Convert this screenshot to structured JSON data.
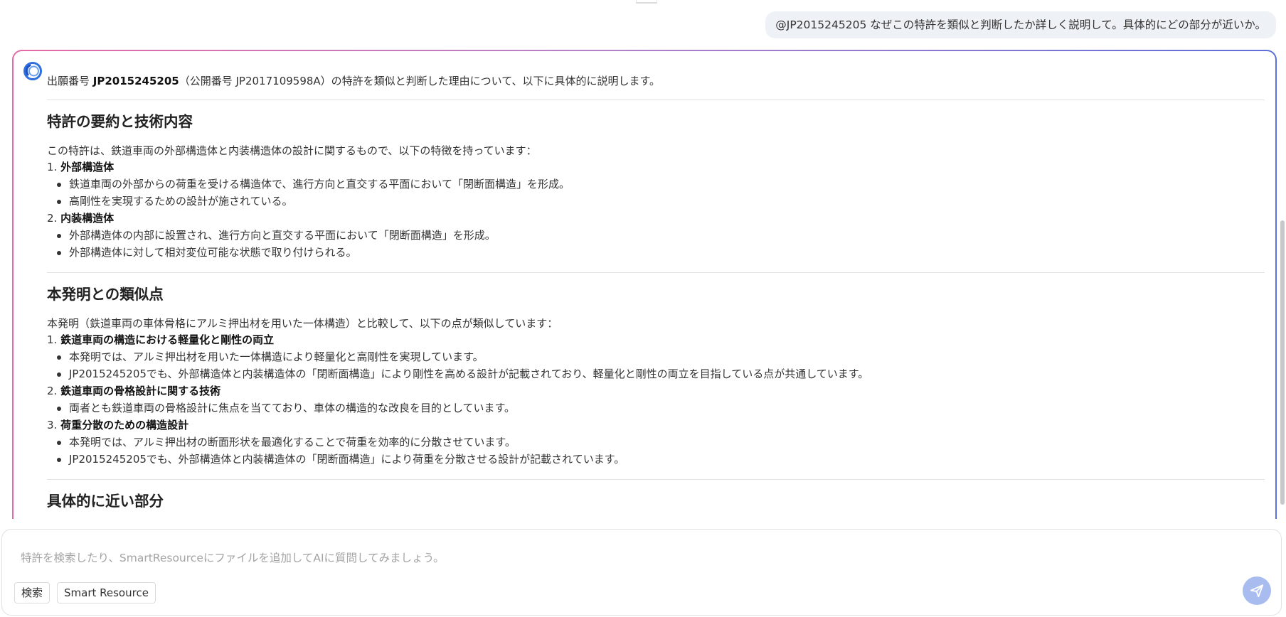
{
  "user_message": "@JP2015245205 なぜこの特許を類似と判断したか詳しく説明して。具体的にどの部分が近いか。",
  "answer": {
    "intro_prefix": "出願番号 ",
    "intro_number": "JP2015245205",
    "intro_suffix": "（公開番号 JP2017109598A）の特許を類似と判断した理由について、以下に具体的に説明します。",
    "section1": {
      "title": "特許の要約と技術内容",
      "lead": "この特許は、鉄道車両の外部構造体と内装構造体の設計に関するもので、以下の特徴を持っています：",
      "items": [
        {
          "num": "1. ",
          "title": "外部構造体",
          "bullets": [
            "鉄道車両の外部からの荷重を受ける構造体で、進行方向と直交する平面において「閉断面構造」を形成。",
            "高剛性を実現するための設計が施されている。"
          ]
        },
        {
          "num": "2. ",
          "title": "内装構造体",
          "bullets": [
            "外部構造体の内部に設置され、進行方向と直交する平面において「閉断面構造」を形成。",
            "外部構造体に対して相対変位可能な状態で取り付けられる。"
          ]
        }
      ]
    },
    "section2": {
      "title": "本発明との類似点",
      "lead": "本発明（鉄道車両の車体骨格にアルミ押出材を用いた一体構造）と比較して、以下の点が類似しています：",
      "items": [
        {
          "num": "1. ",
          "title": "鉄道車両の構造における軽量化と剛性の両立",
          "bullets": [
            "本発明では、アルミ押出材を用いた一体構造により軽量化と高剛性を実現しています。",
            "JP2015245205でも、外部構造体と内装構造体の「閉断面構造」により剛性を高める設計が記載されており、軽量化と剛性の両立を目指している点が共通しています。"
          ]
        },
        {
          "num": "2. ",
          "title": "鉄道車両の骨格設計に関する技術",
          "bullets": [
            "両者とも鉄道車両の骨格設計に焦点を当てており、車体の構造的な改良を目的としています。"
          ]
        },
        {
          "num": "3. ",
          "title": "荷重分散のための構造設計",
          "bullets": [
            "本発明では、アルミ押出材の断面形状を最適化することで荷重を効率的に分散させています。",
            "JP2015245205でも、外部構造体と内装構造体の「閉断面構造」により荷重を分散させる設計が記載されています。"
          ]
        }
      ]
    },
    "section3": {
      "title": "具体的に近い部分"
    }
  },
  "composer": {
    "placeholder": "特許を検索したり、SmartResourceにファイルを追加してAIに質問してみましょう。",
    "value": "",
    "chip_search": "検索",
    "chip_smart": "Smart Resource"
  },
  "colors": {
    "border_pink": "#e46aa6",
    "border_blue": "#5d6fd8",
    "logo_blue": "#2f6fe0",
    "send_button": "#a9bcf0"
  }
}
